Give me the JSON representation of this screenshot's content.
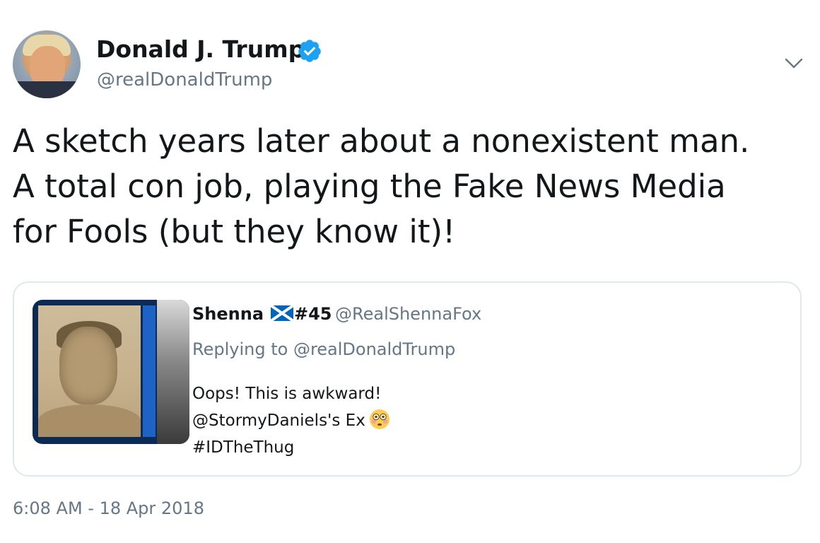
{
  "author": {
    "display_name": "Donald J. Trump",
    "handle": "@realDonaldTrump",
    "verified": true
  },
  "icons": {
    "verified": "verified-badge-icon",
    "menu": "chevron-down-icon",
    "flag": "scotland-flag-icon",
    "emoji": "flushed-face-emoji-icon"
  },
  "tweet": {
    "lines": [
      "A sketch years later about a nonexistent man.",
      "A total con job, playing the Fake News Media",
      "for Fools (but they know it)!"
    ],
    "timestamp": "6:08 AM - 18 Apr 2018"
  },
  "quoted_tweet": {
    "display_name": "Shenna",
    "name_suffix": "#45",
    "handle": "@RealShennaFox",
    "replying_prefix": "Replying to",
    "replying_to": "@realDonaldTrump",
    "body_lines": [
      "Oops! This is awkward!",
      "@StormyDaniels's Ex",
      "#IDTheThug"
    ]
  },
  "colors": {
    "text_primary": "#14171a",
    "text_secondary": "#657786",
    "verified_blue": "#1da1f2",
    "card_border": "#e1e8ed"
  }
}
